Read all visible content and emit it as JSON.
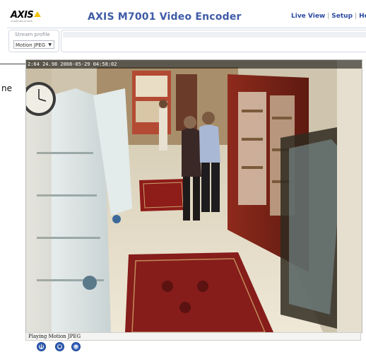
{
  "header": {
    "logo_text": "AXIS",
    "logo_tagline": "COMMUNICATIONS",
    "title": "AXIS M7001 Video Encoder",
    "links": [
      "Live View",
      "Setup",
      "He"
    ],
    "separator": "|"
  },
  "stream_profile": {
    "label": "Stream profile",
    "selected": "Motion JPEG",
    "arrow": "▼"
  },
  "side_caption": "ne",
  "video": {
    "overlay_text": "2:64 24.98 2008-05-29 04:58:02"
  },
  "status": {
    "playing_text": "Playing Motion JPEG"
  },
  "controls": [
    {
      "icon": "pause-icon",
      "glyph": "II"
    },
    {
      "icon": "snapshot-icon",
      "glyph": "◉"
    },
    {
      "icon": "view-full-size-icon",
      "glyph": "▢"
    }
  ],
  "colors": {
    "title": "#3e5ba7",
    "links": "#2c4aa0",
    "logo_accent": "#f2c500",
    "control_button": "#2e5fbd"
  }
}
